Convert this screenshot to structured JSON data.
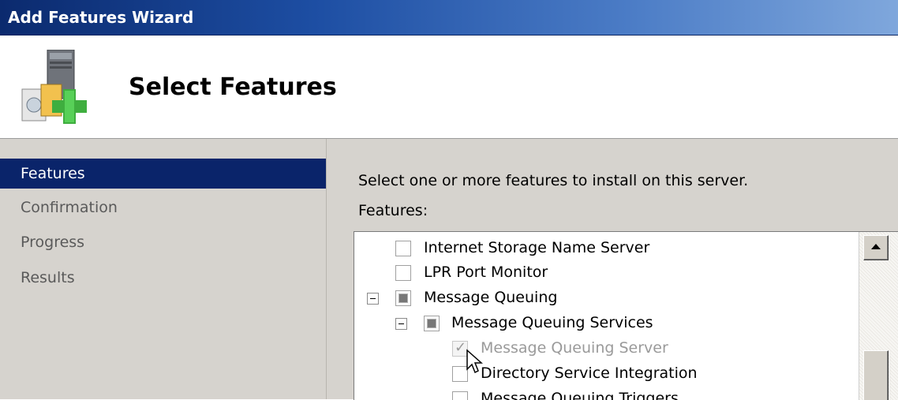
{
  "window": {
    "title": "Add Features Wizard"
  },
  "header": {
    "heading": "Select Features",
    "logo_icon": "server-add-feature-icon"
  },
  "sidebar": {
    "items": [
      {
        "label": "Features",
        "active": true
      },
      {
        "label": "Confirmation",
        "active": false
      },
      {
        "label": "Progress",
        "active": false
      },
      {
        "label": "Results",
        "active": false
      }
    ]
  },
  "main": {
    "intro": "Select one or more features to install on this server.",
    "features_label": "Features:",
    "tree": [
      {
        "label": "Internet Storage Name Server",
        "state": "unchecked"
      },
      {
        "label": "LPR Port Monitor",
        "state": "unchecked"
      },
      {
        "label": "Message Queuing",
        "state": "partial",
        "expanded": true
      },
      {
        "label": "Message Queuing Services",
        "state": "partial",
        "expanded": true
      },
      {
        "label": "Message Queuing Server",
        "state": "checked-disabled"
      },
      {
        "label": "Directory Service Integration",
        "state": "unchecked"
      },
      {
        "label": "Message Queuing Triggers",
        "state": "unchecked"
      }
    ]
  },
  "colors": {
    "selection": "#0a246a",
    "panel": "#d6d3ce",
    "title_start": "#0b2a6e",
    "title_end": "#7fa7dc"
  }
}
